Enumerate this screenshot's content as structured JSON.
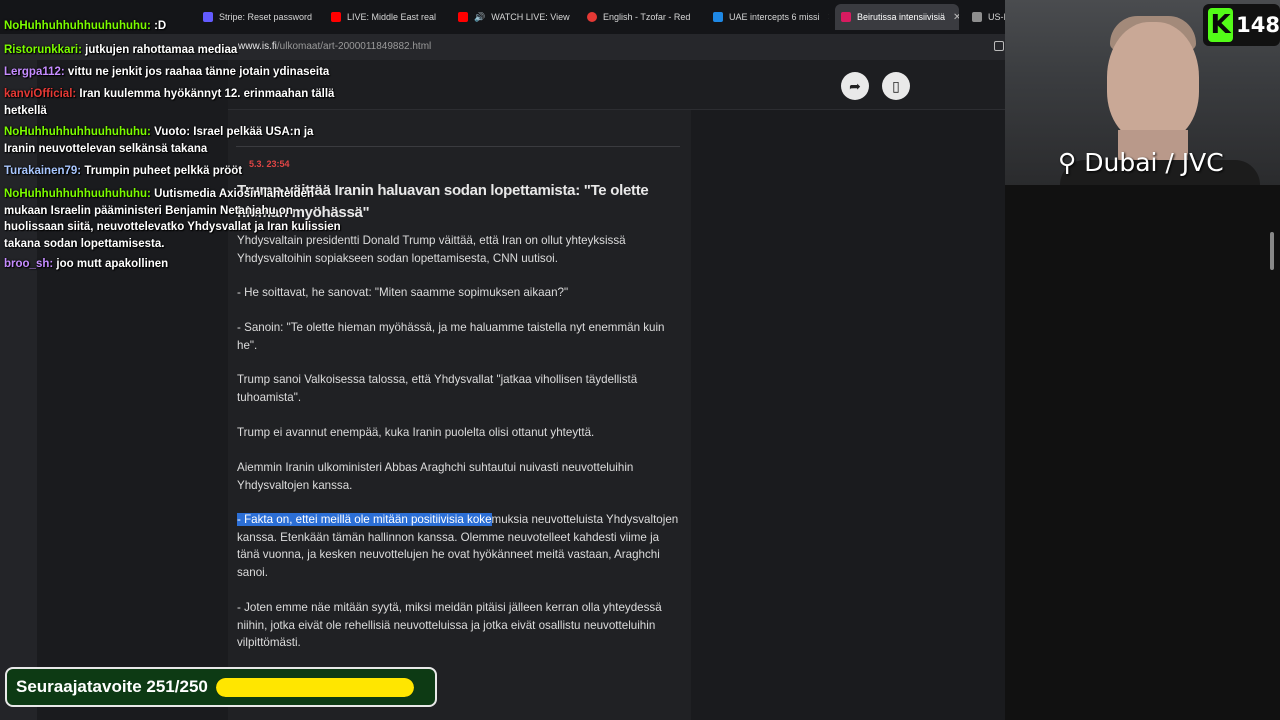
{
  "tabs": [
    {
      "title": "Stripe: Reset password",
      "fav": "#635bff",
      "active": false
    },
    {
      "title": "LIVE: Middle East real",
      "fav": "#ff0000",
      "active": false
    },
    {
      "title": "WATCH LIVE: View",
      "fav": "#ff0000",
      "active": false
    },
    {
      "title": "English - Tzofar - Red",
      "fav": "#e53935",
      "active": false
    },
    {
      "title": "UAE intercepts 6 missi",
      "fav": "#1e88e5",
      "active": false
    },
    {
      "title": "Beirutissa intensiivisiä",
      "fav": "#d81b60",
      "active": true
    },
    {
      "title": "US-Isr",
      "fav": "#8e8e8e",
      "active": false
    }
  ],
  "address": {
    "domain": "www.is.fi",
    "path": "/ulkomaat/art-2000011849882.html"
  },
  "article": {
    "timestamp": "5.3. 23:54",
    "headline": "Trump väittää Iranin haluavan sodan lopettamista: \"Te olette hieman myöhässä\"",
    "paragraphs": [
      "Yhdysvaltain presidentti Donald Trump väittää, että Iran on ollut yhteyksissä Yhdysvaltoihin sopiakseen sodan lopettamisesta, CNN uutisoi.",
      "- He soittavat, he sanovat: \"Miten saamme sopimuksen aikaan?\"",
      "- Sanoin: \"Te olette hieman myöhässä, ja me haluamme taistella nyt enemmän kuin he\".",
      "Trump sanoi Valkoisessa talossa, että Yhdysvallat \"jatkaa vihollisen täydellistä tuhoamista\".",
      "Trump ei avannut enempää, kuka Iranin puolelta olisi ottanut yhteyttä.",
      "Aiemmin Iranin ulkoministeri Abbas Araghchi suhtautui nuivasti neuvotteluihin Yhdysvaltojen kanssa.",
      "- Fakta on, ettei meillä ole mitään positiivisia kokemuksia neuvotteluista Yhdysvaltojen kanssa. Etenkään tämän hallinnon kanssa. Olemme neuvotelleet kahdesti viime ja tänä vuonna, ja kesken neuvottelujen he ovat hyökänneet meitä vastaan, Araghchi sanoi.",
      "- Joten emme näe mitään syytä, miksi meidän pitäisi jälleen kerran olla yhteydessä niihin, jotka eivät ole rehellisiä neuvotteluissa ja jotka eivät osallistu neuvotteluihin vilpittömästi."
    ]
  },
  "chat": [
    {
      "user": "NoHuhhuhhuhhuuhuhuhu",
      "color": "#7cfc00",
      "text": ":D"
    },
    {
      "user": "Ristorunkkari",
      "color": "#7cfc00",
      "text": "jutkujen rahottamaa mediaa"
    },
    {
      "user": "Lergpa112",
      "color": "#c58cff",
      "text": "vittu ne jenkit jos raahaa tänne jotain ydinaseita"
    },
    {
      "user": "kanviOfficial",
      "color": "#e53935",
      "text": "Iran kuulemma hyökännyt 12. erinmaahan tällä hetkellä"
    },
    {
      "user": "NoHuhhuhhuhhuuhuhuhu",
      "color": "#7cfc00",
      "text": "Vuoto: Israel pelkää USA:n ja Iranin neuvottelevan selkänsä takana"
    },
    {
      "user": "Turakainen79",
      "color": "#a9c7ff",
      "text": "Trumpin puheet pelkkä prööt"
    },
    {
      "user": "NoHuhhuhhuhhuuhuhuhu",
      "color": "#7cfc00",
      "text": "Uutismedia Axiosin lähteiden mukaan Israelin pääministeri Benjamin Netanjahu on huolissaan siitä, neuvottelevatko Yhdysvallat ja Iran kulissien takana sodan lopettamisesta."
    },
    {
      "user": "broo_sh",
      "color": "#c58cff",
      "text": "joo mutt apakollinen"
    }
  ],
  "stream": {
    "location": "⚲ Dubai / JVC",
    "viewer_count": "148",
    "kick_letter": "K",
    "goal_label": "Seuraajatavoite 251/250",
    "goal_progress": 1.0
  }
}
